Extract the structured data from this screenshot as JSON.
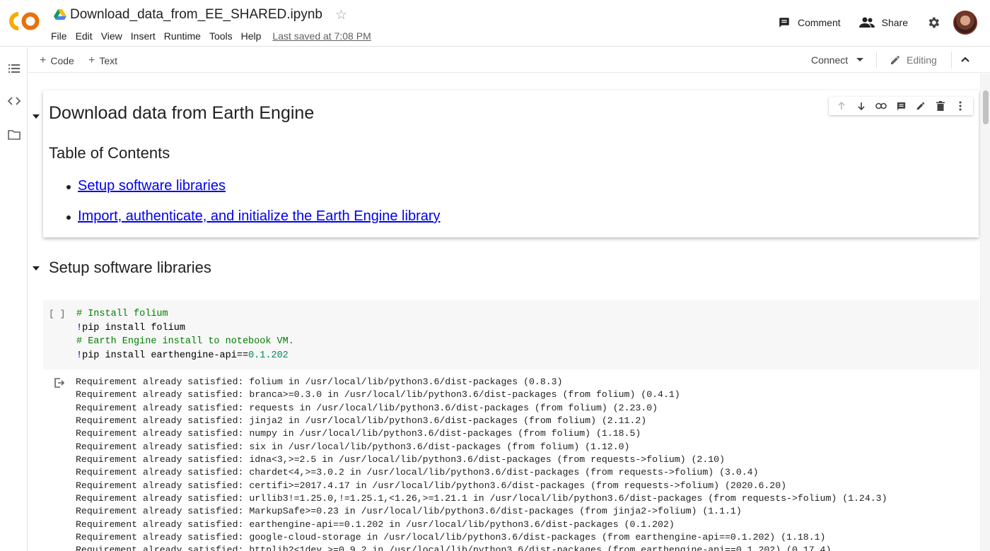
{
  "app": {
    "notebook_title": "Download_data_from_EE_SHARED.ipynb",
    "brand_color": "#f9ab00",
    "brand_text": "CO"
  },
  "menu": [
    "File",
    "Edit",
    "View",
    "Insert",
    "Runtime",
    "Tools",
    "Help"
  ],
  "last_saved": "Last saved at 7:08 PM",
  "header_actions": {
    "comment": "Comment",
    "share": "Share"
  },
  "toolbar": {
    "code": "Code",
    "text": "Text",
    "connect": "Connect",
    "editing": "Editing"
  },
  "text_cell": {
    "title": "Download data from Earth Engine",
    "toc_heading": "Table of Contents",
    "links": [
      "Setup software libraries",
      "Import, authenticate, and initialize the Earth Engine library"
    ]
  },
  "section": {
    "title": "Setup software libraries"
  },
  "code_cell": {
    "run_indicator": "[ ]",
    "lines": [
      {
        "type": "comment",
        "text": "# Install folium"
      },
      {
        "type": "cmd",
        "bang": "!",
        "text": "pip install folium"
      },
      {
        "type": "comment",
        "text": "# Earth Engine install to notebook VM."
      },
      {
        "type": "cmd",
        "bang": "!",
        "text": "pip install earthengine-api==",
        "num": "0.1.202"
      }
    ]
  },
  "output_lines": [
    "Requirement already satisfied: folium in /usr/local/lib/python3.6/dist-packages (0.8.3)",
    "Requirement already satisfied: branca>=0.3.0 in /usr/local/lib/python3.6/dist-packages (from folium) (0.4.1)",
    "Requirement already satisfied: requests in /usr/local/lib/python3.6/dist-packages (from folium) (2.23.0)",
    "Requirement already satisfied: jinja2 in /usr/local/lib/python3.6/dist-packages (from folium) (2.11.2)",
    "Requirement already satisfied: numpy in /usr/local/lib/python3.6/dist-packages (from folium) (1.18.5)",
    "Requirement already satisfied: six in /usr/local/lib/python3.6/dist-packages (from folium) (1.12.0)",
    "Requirement already satisfied: idna<3,>=2.5 in /usr/local/lib/python3.6/dist-packages (from requests->folium) (2.10)",
    "Requirement already satisfied: chardet<4,>=3.0.2 in /usr/local/lib/python3.6/dist-packages (from requests->folium) (3.0.4)",
    "Requirement already satisfied: certifi>=2017.4.17 in /usr/local/lib/python3.6/dist-packages (from requests->folium) (2020.6.20)",
    "Requirement already satisfied: urllib3!=1.25.0,!=1.25.1,<1.26,>=1.21.1 in /usr/local/lib/python3.6/dist-packages (from requests->folium) (1.24.3)",
    "Requirement already satisfied: MarkupSafe>=0.23 in /usr/local/lib/python3.6/dist-packages (from jinja2->folium) (1.1.1)",
    "Requirement already satisfied: earthengine-api==0.1.202 in /usr/local/lib/python3.6/dist-packages (0.1.202)",
    "Requirement already satisfied: google-cloud-storage in /usr/local/lib/python3.6/dist-packages (from earthengine-api==0.1.202) (1.18.1)",
    "Requirement already satisfied: httplib2<1dev,>=0.9.2 in /usr/local/lib/python3.6/dist-packages (from earthengine-api==0.1.202) (0.17.4)"
  ]
}
